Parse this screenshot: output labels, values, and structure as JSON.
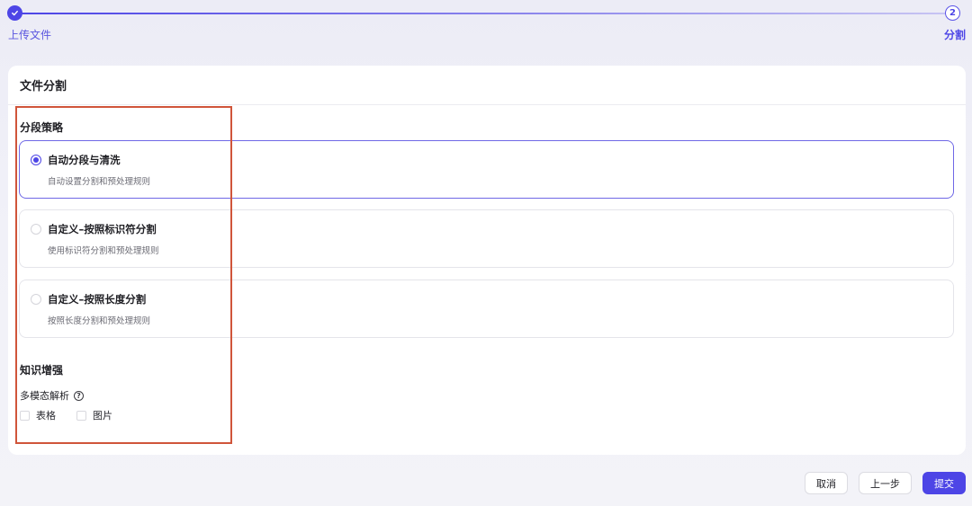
{
  "stepper": {
    "steps": [
      {
        "label": "上传文件",
        "status": "done"
      },
      {
        "label": "分割",
        "number": "2",
        "status": "current"
      }
    ]
  },
  "card": {
    "title": "文件分割",
    "strategy": {
      "title": "分段策略",
      "options": [
        {
          "title": "自动分段与清洗",
          "desc": "自动设置分割和预处理规则",
          "selected": true
        },
        {
          "title": "自定义–按照标识符分割",
          "desc": "使用标识符分割和预处理规则",
          "selected": false
        },
        {
          "title": "自定义–按照长度分割",
          "desc": "按照长度分割和预处理规则",
          "selected": false
        }
      ]
    },
    "enhance": {
      "title": "知识增强",
      "multimodal_label": "多模态解析",
      "help_icon": "?",
      "checks": [
        {
          "label": "表格",
          "checked": false
        },
        {
          "label": "图片",
          "checked": false
        }
      ]
    }
  },
  "footer": {
    "cancel": "取消",
    "prev": "上一步",
    "submit": "提交"
  },
  "colors": {
    "accent": "#4d45e6",
    "annotation": "#d0553a"
  }
}
